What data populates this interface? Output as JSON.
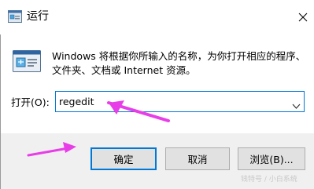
{
  "window": {
    "title": "运行",
    "close_glyph": "✕"
  },
  "dialog": {
    "description": "Windows 将根据你所输入的名称，为你打开相应的程序、文件夹、文档或 Internet 资源。",
    "open_label": "打开(O):",
    "open_value": "regedit"
  },
  "buttons": {
    "ok": "确定",
    "cancel": "取消",
    "browse": "浏览(B)..."
  },
  "watermark": "钱特号 / 小白系统",
  "colors": {
    "accent": "#0078d7",
    "annotation_arrow": "#e83ee8",
    "footer_bg": "#f0f0f0"
  },
  "icons": {
    "app": "run-icon",
    "big": "run-window-icon",
    "close": "close-icon",
    "dropdown": "chevron-down-icon"
  }
}
